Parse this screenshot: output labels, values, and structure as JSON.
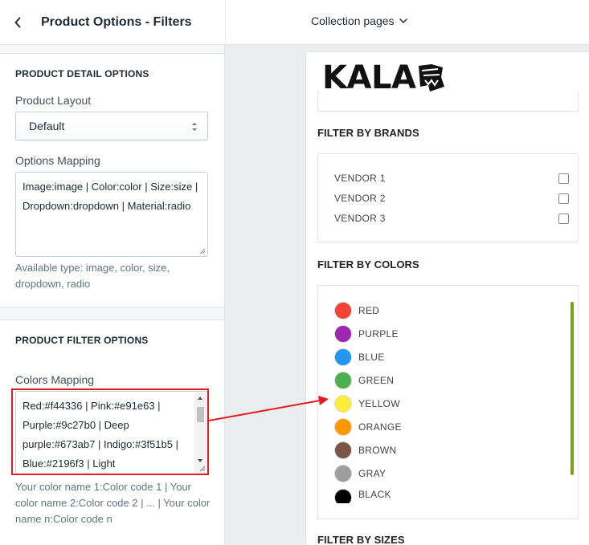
{
  "header": {
    "title": "Product Options - Filters",
    "back_icon": "chevron-left-icon"
  },
  "topbar": {
    "page_select_label": "Collection pages"
  },
  "product_detail": {
    "section_title": "PRODUCT DETAIL OPTIONS",
    "layout_label": "Product Layout",
    "layout_value": "Default",
    "mapping_label": "Options Mapping",
    "mapping_value": "Image:image | Color:color | Size:size | Dropdown:dropdown | Material:radio",
    "mapping_help": "Available type: image, color, size, dropdown, radio"
  },
  "product_filter": {
    "section_title": "PRODUCT FILTER OPTIONS",
    "colors_label": "Colors Mapping",
    "colors_value": "Red:#f44336 | Pink:#e91e63 | Purple:#9c27b0 | Deep purple:#673ab7 | Indigo:#3f51b5 | Blue:#2196f3 | Light",
    "colors_help": "Your color name 1:Color code 1 | Your color name 2:Color code 2 | ... | Your color name n:Color code n"
  },
  "preview": {
    "logo_text": "KALA",
    "brands_title": "FILTER BY BRANDS",
    "vendors": [
      "VENDOR 1",
      "VENDOR 2",
      "VENDOR 3"
    ],
    "colors_title": "FILTER BY COLORS",
    "colors": [
      {
        "name": "RED",
        "hex": "#f44336"
      },
      {
        "name": "PURPLE",
        "hex": "#9c27b0"
      },
      {
        "name": "BLUE",
        "hex": "#2196f3"
      },
      {
        "name": "GREEN",
        "hex": "#4caf50"
      },
      {
        "name": "YELLOW",
        "hex": "#ffeb3b"
      },
      {
        "name": "ORANGE",
        "hex": "#ff9800"
      },
      {
        "name": "BROWN",
        "hex": "#795548"
      },
      {
        "name": "GRAY",
        "hex": "#9e9e9e"
      },
      {
        "name": "BLACK",
        "hex": "#000000"
      }
    ],
    "sizes_title": "FILTER BY SIZES"
  },
  "accent_colors": {
    "annotation_red": "#e01e1e",
    "scroll_green": "#7aa11a"
  }
}
